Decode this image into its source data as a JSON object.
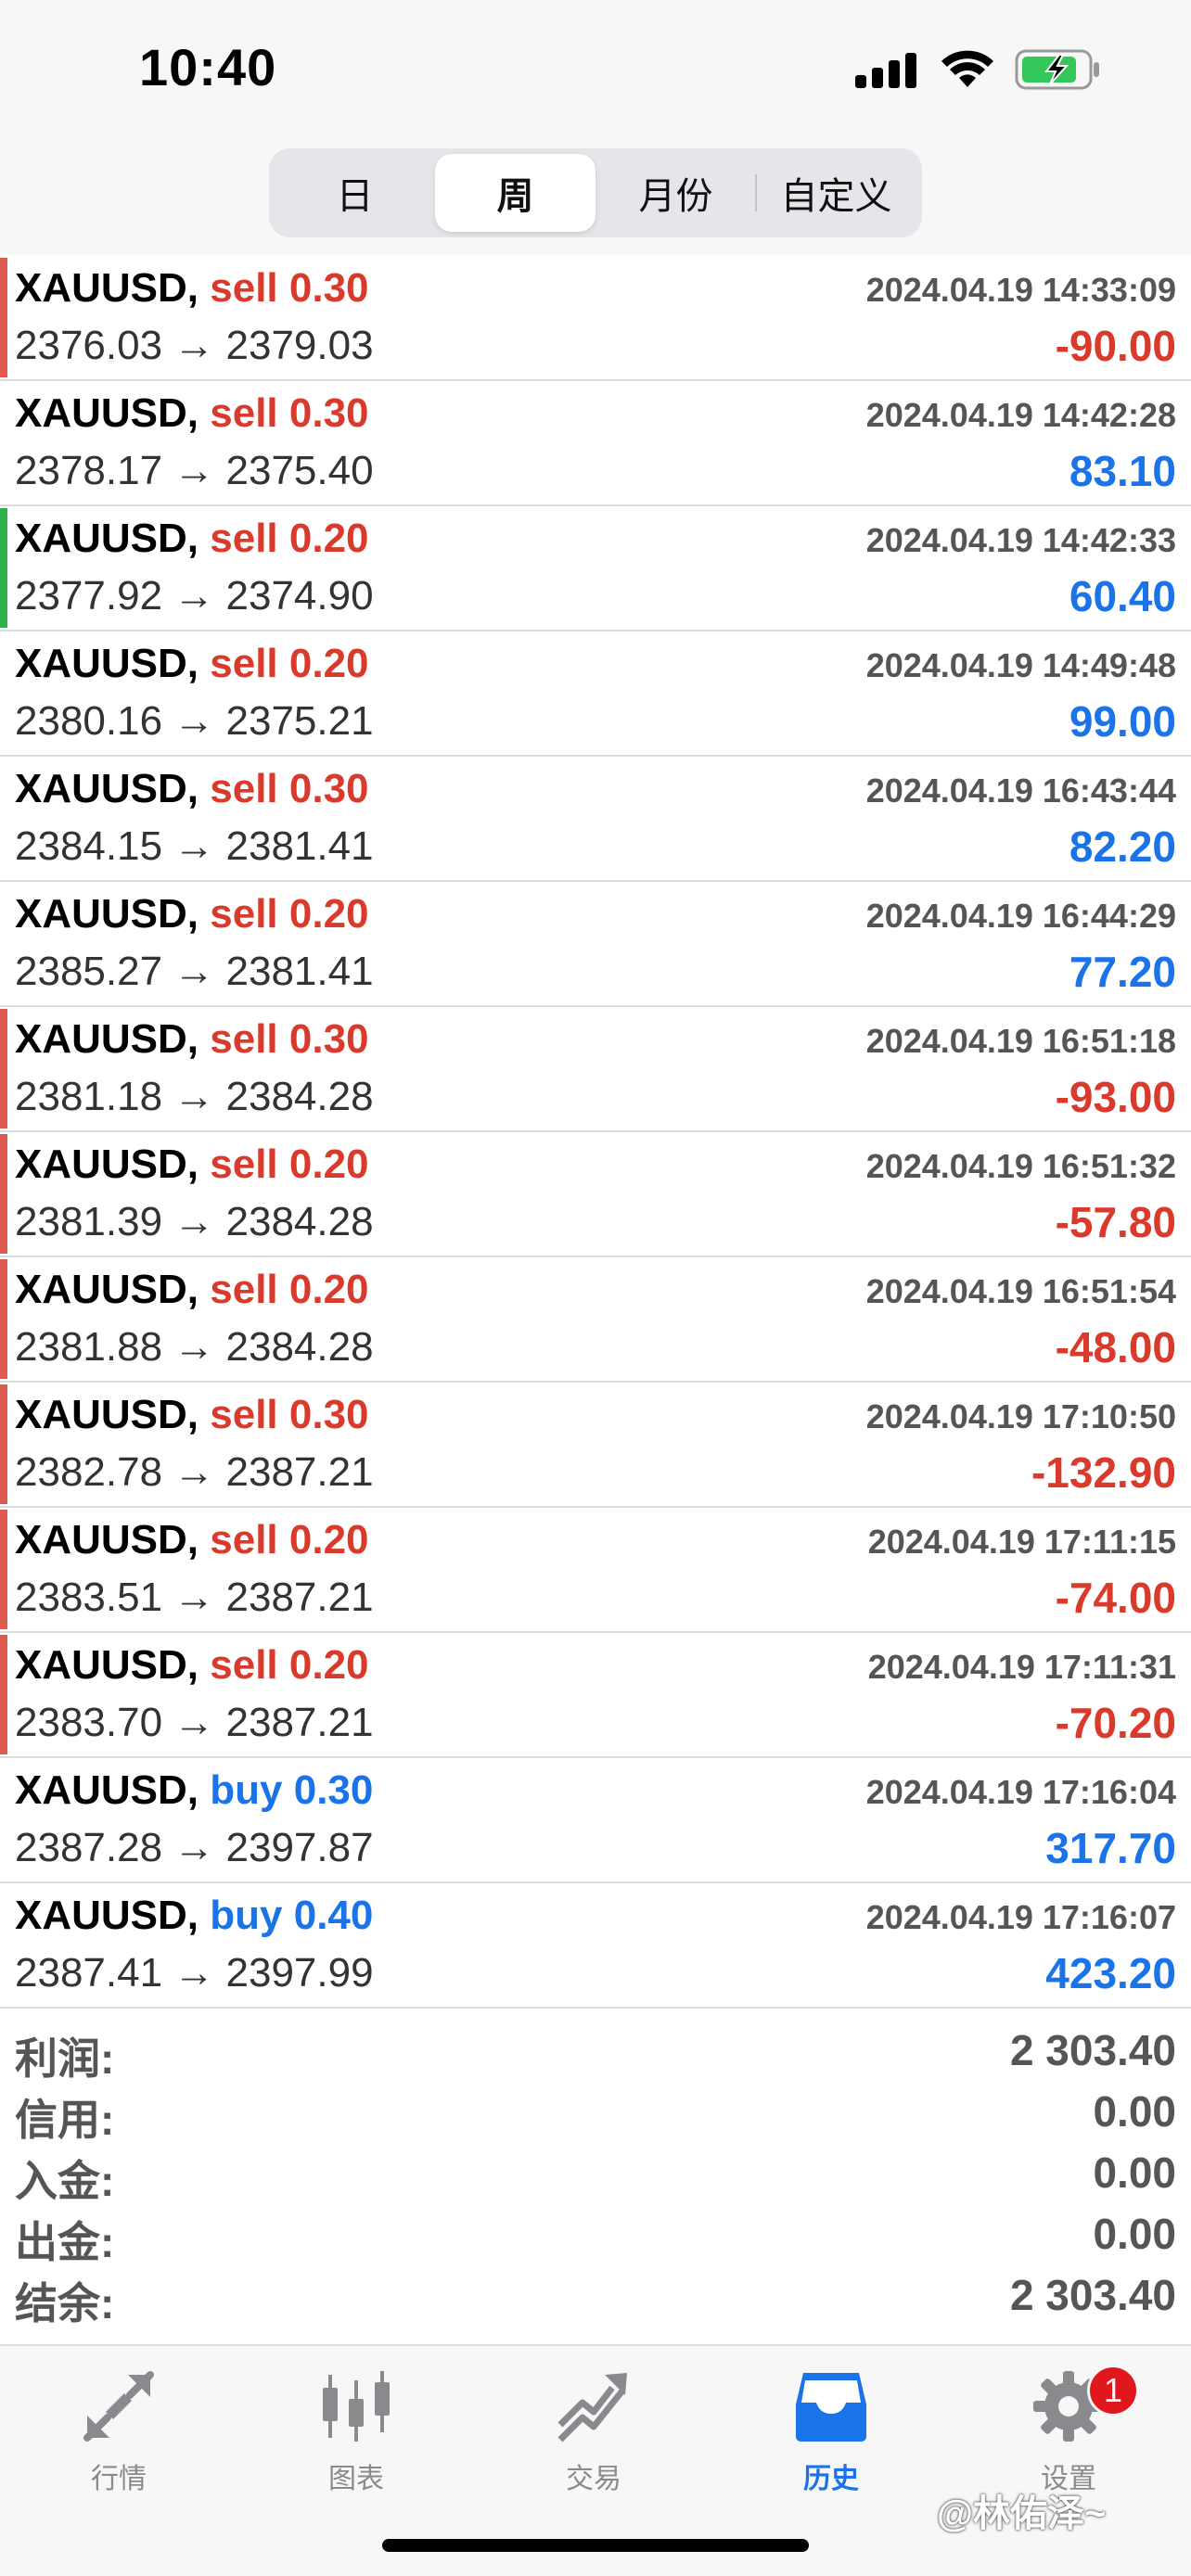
{
  "status_bar": {
    "time": "10:40"
  },
  "period_tabs": [
    {
      "label": "日",
      "active": false
    },
    {
      "label": "周",
      "active": true
    },
    {
      "label": "月份",
      "active": false
    },
    {
      "label": "自定义",
      "active": false
    }
  ],
  "colors": {
    "sell": "#d93a2b",
    "buy": "#1a73e8",
    "loss": "#d93a2b",
    "gain": "#1a73e8",
    "bar_loss": "#e05a50",
    "bar_gain": "#2db14a"
  },
  "deals": [
    {
      "symbol": "XAUUSD,",
      "side": "sell",
      "volume": "0.30",
      "open": "2376.03",
      "close": "2379.03",
      "time": "2024.04.19 14:33:09",
      "profit": "-90.00",
      "bar": "loss"
    },
    {
      "symbol": "XAUUSD,",
      "side": "sell",
      "volume": "0.30",
      "open": "2378.17",
      "close": "2375.40",
      "time": "2024.04.19 14:42:28",
      "profit": "83.10",
      "bar": "none"
    },
    {
      "symbol": "XAUUSD,",
      "side": "sell",
      "volume": "0.20",
      "open": "2377.92",
      "close": "2374.90",
      "time": "2024.04.19 14:42:33",
      "profit": "60.40",
      "bar": "gain"
    },
    {
      "symbol": "XAUUSD,",
      "side": "sell",
      "volume": "0.20",
      "open": "2380.16",
      "close": "2375.21",
      "time": "2024.04.19 14:49:48",
      "profit": "99.00",
      "bar": "none"
    },
    {
      "symbol": "XAUUSD,",
      "side": "sell",
      "volume": "0.30",
      "open": "2384.15",
      "close": "2381.41",
      "time": "2024.04.19 16:43:44",
      "profit": "82.20",
      "bar": "none"
    },
    {
      "symbol": "XAUUSD,",
      "side": "sell",
      "volume": "0.20",
      "open": "2385.27",
      "close": "2381.41",
      "time": "2024.04.19 16:44:29",
      "profit": "77.20",
      "bar": "none"
    },
    {
      "symbol": "XAUUSD,",
      "side": "sell",
      "volume": "0.30",
      "open": "2381.18",
      "close": "2384.28",
      "time": "2024.04.19 16:51:18",
      "profit": "-93.00",
      "bar": "loss"
    },
    {
      "symbol": "XAUUSD,",
      "side": "sell",
      "volume": "0.20",
      "open": "2381.39",
      "close": "2384.28",
      "time": "2024.04.19 16:51:32",
      "profit": "-57.80",
      "bar": "loss"
    },
    {
      "symbol": "XAUUSD,",
      "side": "sell",
      "volume": "0.20",
      "open": "2381.88",
      "close": "2384.28",
      "time": "2024.04.19 16:51:54",
      "profit": "-48.00",
      "bar": "loss"
    },
    {
      "symbol": "XAUUSD,",
      "side": "sell",
      "volume": "0.30",
      "open": "2382.78",
      "close": "2387.21",
      "time": "2024.04.19 17:10:50",
      "profit": "-132.90",
      "bar": "loss"
    },
    {
      "symbol": "XAUUSD,",
      "side": "sell",
      "volume": "0.20",
      "open": "2383.51",
      "close": "2387.21",
      "time": "2024.04.19 17:11:15",
      "profit": "-74.00",
      "bar": "loss"
    },
    {
      "symbol": "XAUUSD,",
      "side": "sell",
      "volume": "0.20",
      "open": "2383.70",
      "close": "2387.21",
      "time": "2024.04.19 17:11:31",
      "profit": "-70.20",
      "bar": "loss"
    },
    {
      "symbol": "XAUUSD,",
      "side": "buy",
      "volume": "0.30",
      "open": "2387.28",
      "close": "2397.87",
      "time": "2024.04.19 17:16:04",
      "profit": "317.70",
      "bar": "none"
    },
    {
      "symbol": "XAUUSD,",
      "side": "buy",
      "volume": "0.40",
      "open": "2387.41",
      "close": "2397.99",
      "time": "2024.04.19 17:16:07",
      "profit": "423.20",
      "bar": "none"
    }
  ],
  "summary": [
    {
      "label": "利润:",
      "value": "2 303.40"
    },
    {
      "label": "信用:",
      "value": "0.00"
    },
    {
      "label": "入金:",
      "value": "0.00"
    },
    {
      "label": "出金:",
      "value": "0.00"
    },
    {
      "label": "结余:",
      "value": "2 303.40"
    }
  ],
  "tabs": [
    {
      "label": "行情",
      "icon": "quotes-icon",
      "active": false
    },
    {
      "label": "图表",
      "icon": "chart-icon",
      "active": false
    },
    {
      "label": "交易",
      "icon": "trade-icon",
      "active": false
    },
    {
      "label": "历史",
      "icon": "history-icon",
      "active": true
    },
    {
      "label": "设置",
      "icon": "gear-icon",
      "active": false,
      "badge": "1"
    }
  ],
  "watermark": "@林佑泽~"
}
